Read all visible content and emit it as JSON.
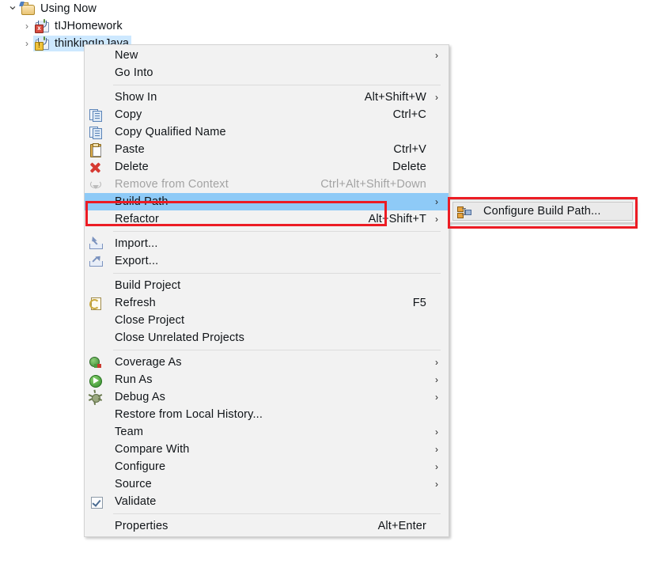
{
  "tree": {
    "items": [
      {
        "label": "Using Now",
        "twisty": "v",
        "icon": "workspace-folder-icon",
        "level": 0,
        "selected": false,
        "badge": ""
      },
      {
        "label": "tIJHomework",
        "twisty": ">",
        "icon": "java-project-icon",
        "level": 1,
        "selected": false,
        "badge": "error"
      },
      {
        "label": "thinkingInJava",
        "twisty": ">",
        "icon": "java-project-icon",
        "level": 1,
        "selected": true,
        "badge": "warning"
      }
    ]
  },
  "context_menu": {
    "items": [
      {
        "label": "New",
        "accel": "",
        "icon": "",
        "arrow": true,
        "sep_after": false,
        "selected": false,
        "disabled": false
      },
      {
        "label": "Go Into",
        "accel": "",
        "icon": "",
        "arrow": false,
        "sep_after": true,
        "selected": false,
        "disabled": false
      },
      {
        "label": "Show In",
        "accel": "Alt+Shift+W",
        "icon": "",
        "arrow": true,
        "sep_after": false,
        "selected": false,
        "disabled": false
      },
      {
        "label": "Copy",
        "accel": "Ctrl+C",
        "icon": "copy-icon",
        "arrow": false,
        "sep_after": false,
        "selected": false,
        "disabled": false
      },
      {
        "label": "Copy Qualified Name",
        "accel": "",
        "icon": "copy-icon",
        "arrow": false,
        "sep_after": false,
        "selected": false,
        "disabled": false
      },
      {
        "label": "Paste",
        "accel": "Ctrl+V",
        "icon": "paste-icon",
        "arrow": false,
        "sep_after": false,
        "selected": false,
        "disabled": false
      },
      {
        "label": "Delete",
        "accel": "Delete",
        "icon": "delete-icon",
        "arrow": false,
        "sep_after": false,
        "selected": false,
        "disabled": false
      },
      {
        "label": "Remove from Context",
        "accel": "Ctrl+Alt+Shift+Down",
        "icon": "context-icon",
        "arrow": false,
        "sep_after": false,
        "selected": false,
        "disabled": true
      },
      {
        "label": "Build Path",
        "accel": "",
        "icon": "",
        "arrow": true,
        "sep_after": false,
        "selected": true,
        "disabled": false
      },
      {
        "label": "Refactor",
        "accel": "Alt+Shift+T",
        "icon": "",
        "arrow": true,
        "sep_after": true,
        "selected": false,
        "disabled": false
      },
      {
        "label": "Import...",
        "accel": "",
        "icon": "import-icon",
        "arrow": false,
        "sep_after": false,
        "selected": false,
        "disabled": false
      },
      {
        "label": "Export...",
        "accel": "",
        "icon": "export-icon",
        "arrow": false,
        "sep_after": true,
        "selected": false,
        "disabled": false
      },
      {
        "label": "Build Project",
        "accel": "",
        "icon": "",
        "arrow": false,
        "sep_after": false,
        "selected": false,
        "disabled": false
      },
      {
        "label": "Refresh",
        "accel": "F5",
        "icon": "refresh-icon",
        "arrow": false,
        "sep_after": false,
        "selected": false,
        "disabled": false
      },
      {
        "label": "Close Project",
        "accel": "",
        "icon": "",
        "arrow": false,
        "sep_after": false,
        "selected": false,
        "disabled": false
      },
      {
        "label": "Close Unrelated Projects",
        "accel": "",
        "icon": "",
        "arrow": false,
        "sep_after": true,
        "selected": false,
        "disabled": false
      },
      {
        "label": "Coverage As",
        "accel": "",
        "icon": "coverage-icon",
        "arrow": true,
        "sep_after": false,
        "selected": false,
        "disabled": false
      },
      {
        "label": "Run As",
        "accel": "",
        "icon": "run-icon",
        "arrow": true,
        "sep_after": false,
        "selected": false,
        "disabled": false
      },
      {
        "label": "Debug As",
        "accel": "",
        "icon": "debug-icon",
        "arrow": true,
        "sep_after": false,
        "selected": false,
        "disabled": false
      },
      {
        "label": "Restore from Local History...",
        "accel": "",
        "icon": "",
        "arrow": false,
        "sep_after": false,
        "selected": false,
        "disabled": false
      },
      {
        "label": "Team",
        "accel": "",
        "icon": "",
        "arrow": true,
        "sep_after": false,
        "selected": false,
        "disabled": false
      },
      {
        "label": "Compare With",
        "accel": "",
        "icon": "",
        "arrow": true,
        "sep_after": false,
        "selected": false,
        "disabled": false
      },
      {
        "label": "Configure",
        "accel": "",
        "icon": "",
        "arrow": true,
        "sep_after": false,
        "selected": false,
        "disabled": false
      },
      {
        "label": "Source",
        "accel": "",
        "icon": "",
        "arrow": true,
        "sep_after": false,
        "selected": false,
        "disabled": false
      },
      {
        "label": "Validate",
        "accel": "",
        "icon": "checkbox-checked-icon",
        "arrow": false,
        "sep_after": true,
        "selected": false,
        "disabled": false
      },
      {
        "label": "Properties",
        "accel": "Alt+Enter",
        "icon": "",
        "arrow": false,
        "sep_after": false,
        "selected": false,
        "disabled": false
      }
    ]
  },
  "submenu": {
    "items": [
      {
        "label": "Configure Build Path...",
        "icon": "build-path-icon",
        "hover": true
      }
    ]
  },
  "annotations": {
    "highlight_color": "#ec1c24",
    "selection_color": "#8ecaf7",
    "tree_selection_color": "#cde8ff"
  }
}
